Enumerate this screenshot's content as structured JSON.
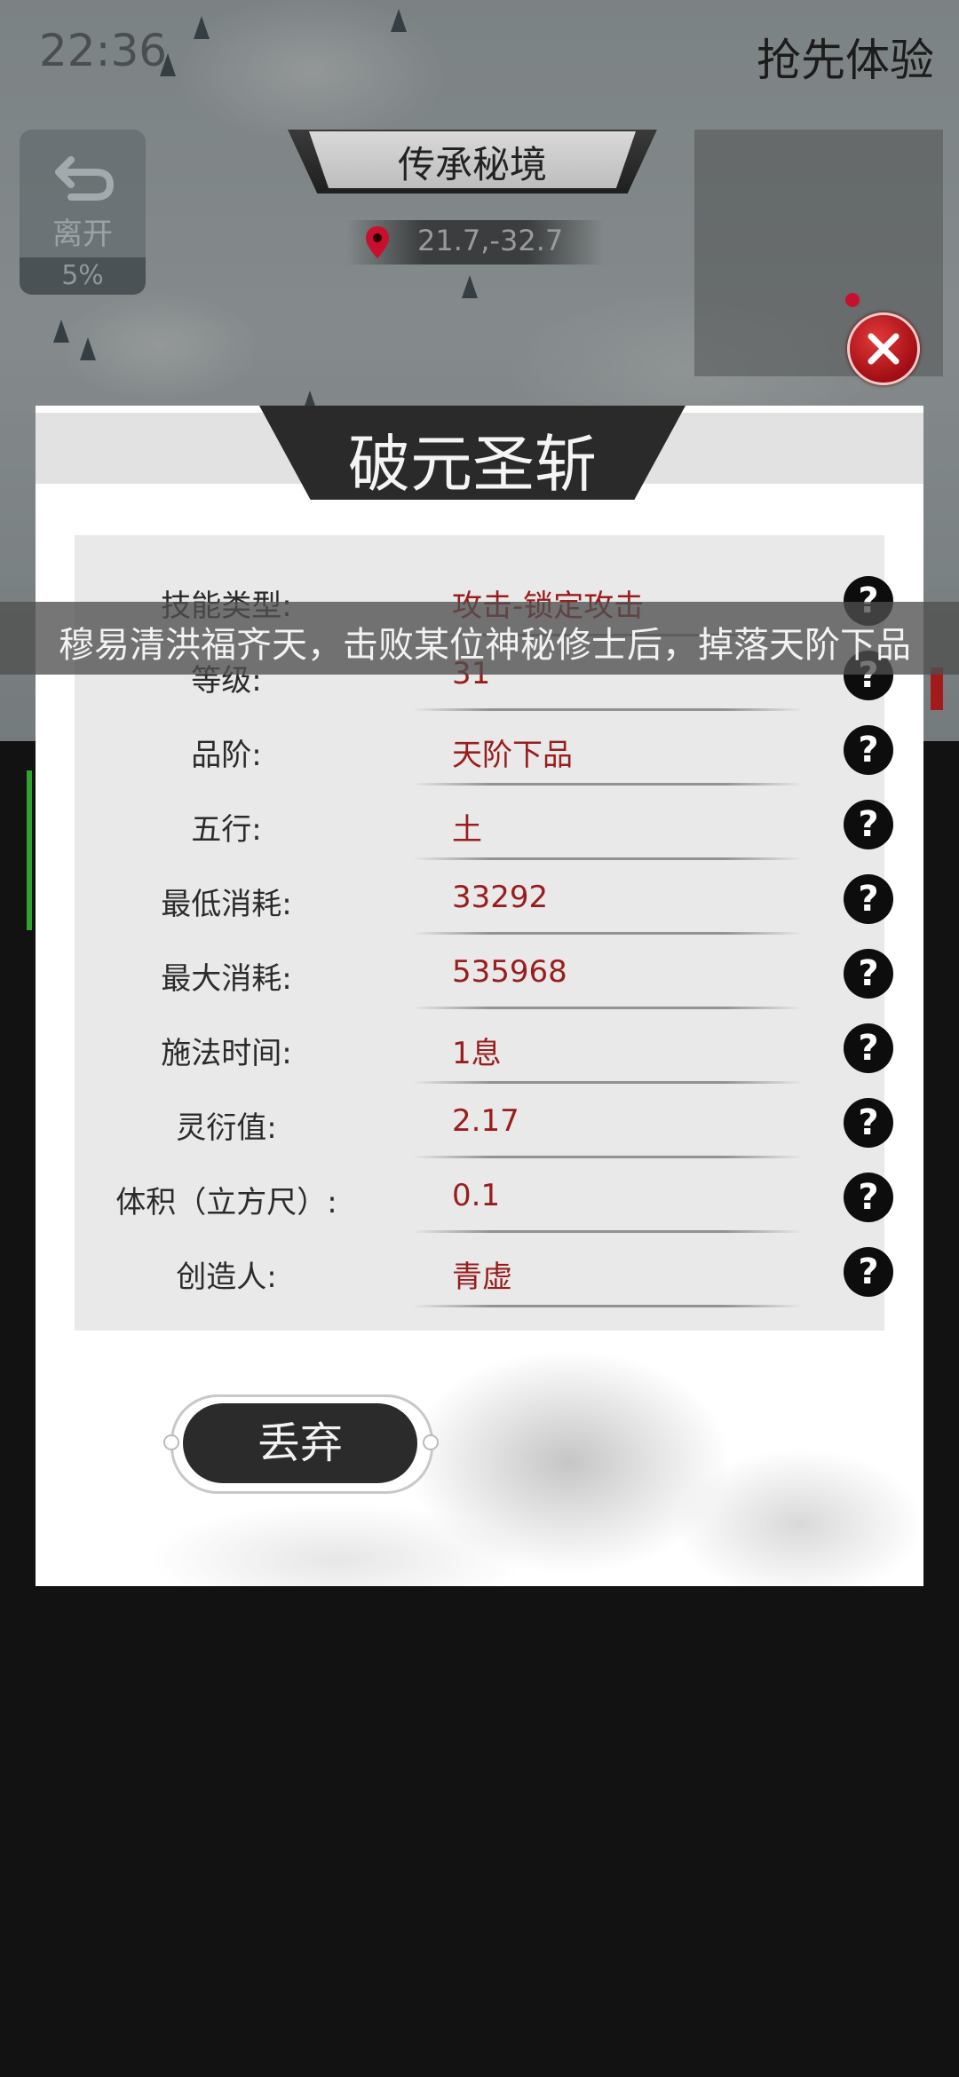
{
  "status_bar": {
    "time": "22:36"
  },
  "header": {
    "top_right_label": "抢先体验",
    "leave": {
      "label": "离开",
      "percent": "5%"
    },
    "map_title": "传承秘境",
    "coords": "21.7,-32.7"
  },
  "announcement": "穆易清洪福齐天，击败某位神秘修士后，掉落天阶下品",
  "dialog": {
    "title": "破元圣斩",
    "stats": [
      {
        "label": "技能类型:",
        "value": "攻击-锁定攻击"
      },
      {
        "label": "等级:",
        "value": "31"
      },
      {
        "label": "品阶:",
        "value": "天阶下品"
      },
      {
        "label": "五行:",
        "value": "土"
      },
      {
        "label": "最低消耗:",
        "value": "33292"
      },
      {
        "label": "最大消耗:",
        "value": "535968"
      },
      {
        "label": "施法时间:",
        "value": "1息"
      },
      {
        "label": "灵衍值:",
        "value": "2.17"
      },
      {
        "label": "体积（立方尺）:",
        "value": "0.1"
      },
      {
        "label": "创造人:",
        "value": "青虚"
      }
    ],
    "help_glyph": "?",
    "discard_label": "丢弃"
  },
  "colors": {
    "value_red": "#9a1d1d",
    "close_red": "#c8102e",
    "panel_dark": "#2a2a2a"
  },
  "icons": [
    "return-arrow-icon",
    "location-pin-icon",
    "close-icon",
    "help-icon"
  ]
}
